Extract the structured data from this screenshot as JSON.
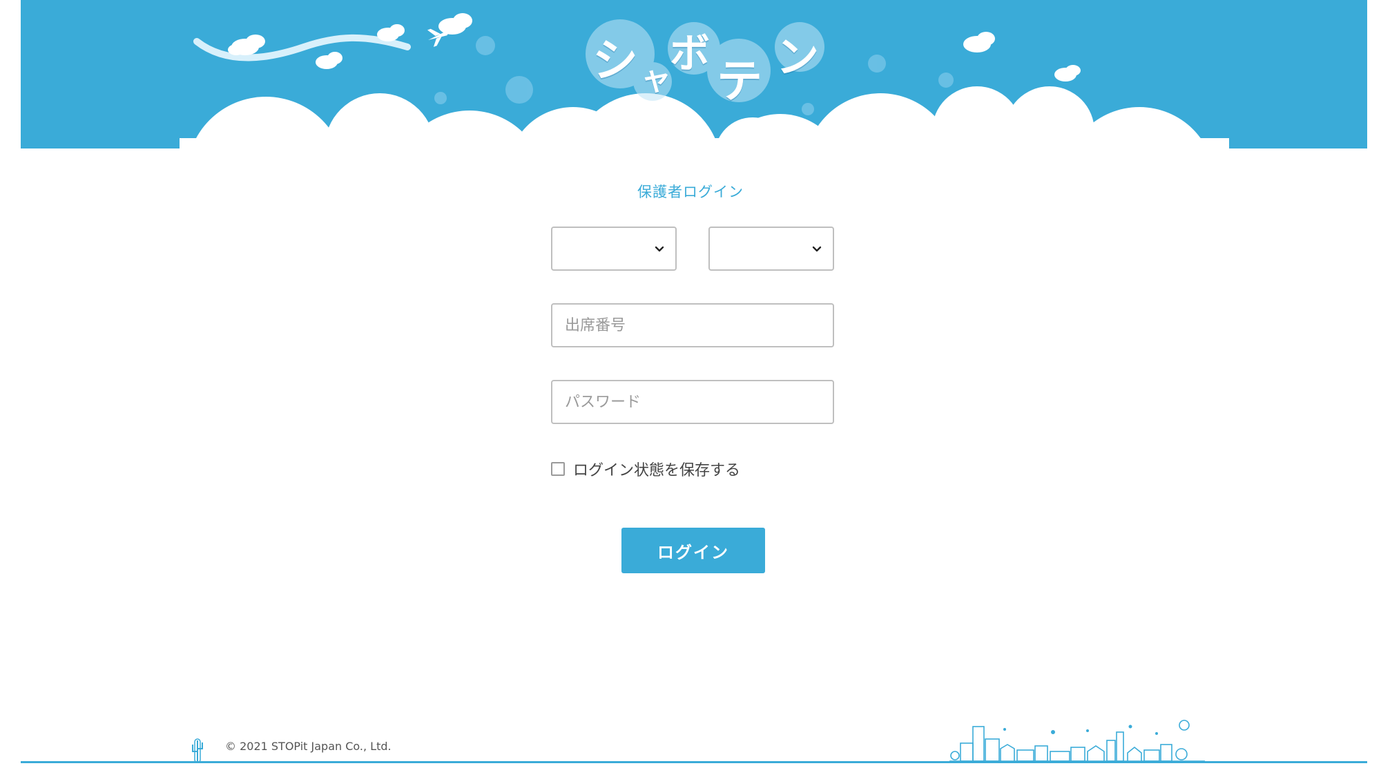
{
  "header": {
    "logo_chars": [
      "シ",
      "ャ",
      "ボ",
      "テ",
      "ン"
    ],
    "brand_color": "#3aabd8"
  },
  "login": {
    "title": "保護者ログイン",
    "select_1": {
      "value": ""
    },
    "select_2": {
      "value": ""
    },
    "attendance_placeholder": "出席番号",
    "password_placeholder": "パスワード",
    "remember_label": "ログイン状態を保存する",
    "remember_checked": false,
    "submit_label": "ログイン"
  },
  "footer": {
    "copyright": "© 2021 STOPit Japan Co., Ltd."
  }
}
